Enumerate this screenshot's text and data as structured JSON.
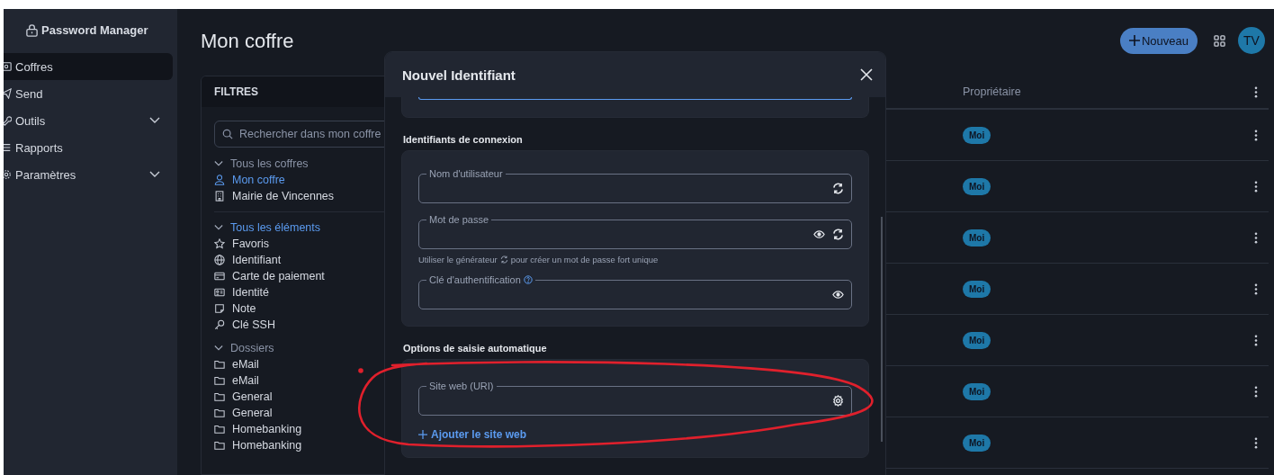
{
  "app": {
    "name": "Password Manager"
  },
  "sidebar": {
    "items": [
      {
        "label": "Coffres",
        "selected": true,
        "expandable": false
      },
      {
        "label": "Send",
        "selected": false,
        "expandable": false
      },
      {
        "label": "Outils",
        "selected": false,
        "expandable": true
      },
      {
        "label": "Rapports",
        "selected": false,
        "expandable": false
      },
      {
        "label": "Paramètres",
        "selected": false,
        "expandable": true
      }
    ]
  },
  "page_title": "Mon coffre",
  "header": {
    "new_button": "Nouveau",
    "avatar": "TV"
  },
  "filters": {
    "title": "FILTRES",
    "search": {
      "placeholder": "Rechercher dans mon coffre"
    },
    "groups": [
      {
        "label": "Tous les coffres",
        "selected": false,
        "items": [
          {
            "label": "Mon coffre",
            "kind": "person",
            "selected": true
          },
          {
            "label": "Mairie de Vincennes",
            "kind": "building",
            "selected": false
          }
        ]
      },
      {
        "label": "Tous les éléments",
        "selected": true,
        "items": [
          {
            "label": "Favoris",
            "kind": "star",
            "selected": false
          },
          {
            "label": "Identifiant",
            "kind": "globe",
            "selected": false
          },
          {
            "label": "Carte de paiement",
            "kind": "card",
            "selected": false
          },
          {
            "label": "Identité",
            "kind": "idcard",
            "selected": false
          },
          {
            "label": "Note",
            "kind": "note",
            "selected": false
          },
          {
            "label": "Clé SSH",
            "kind": "key",
            "selected": false
          }
        ]
      },
      {
        "label": "Dossiers",
        "selected": false,
        "items": [
          {
            "label": "eMail",
            "kind": "folder",
            "selected": false
          },
          {
            "label": "eMail",
            "kind": "folder",
            "selected": false
          },
          {
            "label": "General",
            "kind": "folder",
            "selected": false
          },
          {
            "label": "General",
            "kind": "folder",
            "selected": false
          },
          {
            "label": "Homebanking",
            "kind": "folder",
            "selected": false
          },
          {
            "label": "Homebanking",
            "kind": "folder",
            "selected": false
          }
        ]
      }
    ]
  },
  "table": {
    "columns": [
      {
        "label": "Propriétaire"
      }
    ],
    "rows": [
      {
        "owner": "Moi"
      },
      {
        "owner": "Moi"
      },
      {
        "owner": "Moi"
      },
      {
        "owner": "Moi"
      },
      {
        "owner": "Moi"
      },
      {
        "owner": "Moi"
      },
      {
        "owner": "Moi"
      }
    ]
  },
  "dialog": {
    "title": "Nouvel Identifiant",
    "sections": [
      {
        "title": "Identifiants de connexion",
        "fields": [
          {
            "label": "Nom d'utilisateur",
            "kind": "username",
            "help": false
          },
          {
            "label": "Mot de passe",
            "kind": "password",
            "help": false,
            "hint_before": "Utiliser le générateur",
            "hint_after": "pour créer un mot de passe fort unique"
          },
          {
            "label": "Clé d'authentification",
            "kind": "totp",
            "help": true
          }
        ]
      },
      {
        "title": "Options de saisie automatique",
        "fields": [
          {
            "label": "Site web (URI)",
            "kind": "uri",
            "help": false
          }
        ],
        "add_link": "Ajouter le site web"
      }
    ]
  },
  "annotations": [
    {
      "kind": "freehand-ellipse"
    }
  ]
}
